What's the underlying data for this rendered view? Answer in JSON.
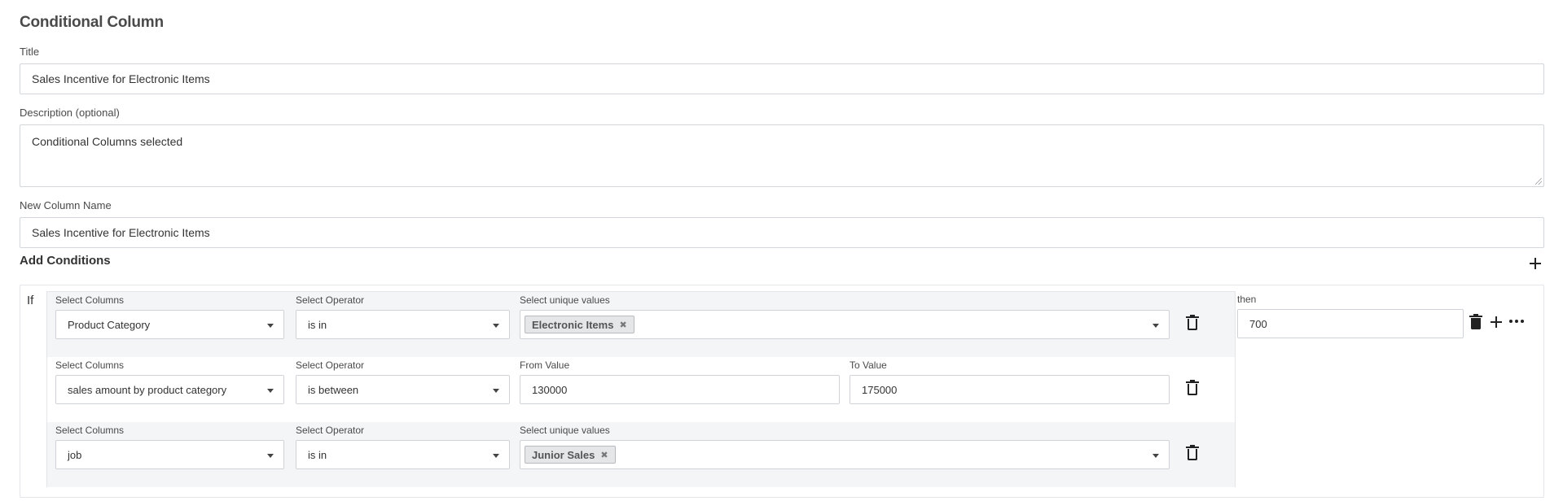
{
  "page": {
    "heading": "Conditional Column"
  },
  "form": {
    "title_label": "Title",
    "title_value": "Sales Incentive for Electronic Items",
    "description_label": "Description (optional)",
    "description_value": "Conditional Columns selected",
    "new_column_label": "New Column Name",
    "new_column_value": "Sales Incentive for Electronic Items"
  },
  "conditions": {
    "section_title": "Add Conditions",
    "if_label": "If",
    "then_label": "then",
    "then_value": "700",
    "rules": [
      {
        "column_label": "Select Columns",
        "column_value": "Product Category",
        "operator_label": "Select Operator",
        "operator_value": "is in",
        "values_label": "Select unique values",
        "chip": "Electronic Items"
      },
      {
        "column_label": "Select Columns",
        "column_value": "sales amount by product category",
        "operator_label": "Select Operator",
        "operator_value": "is between",
        "from_label": "From Value",
        "from_value": "130000",
        "to_label": "To Value",
        "to_value": "175000"
      },
      {
        "column_label": "Select Columns",
        "column_value": "job",
        "operator_label": "Select Operator",
        "operator_value": "is in",
        "values_label": "Select unique values",
        "chip": "Junior Sales"
      }
    ]
  },
  "icons": {
    "chip_remove": "✖"
  }
}
